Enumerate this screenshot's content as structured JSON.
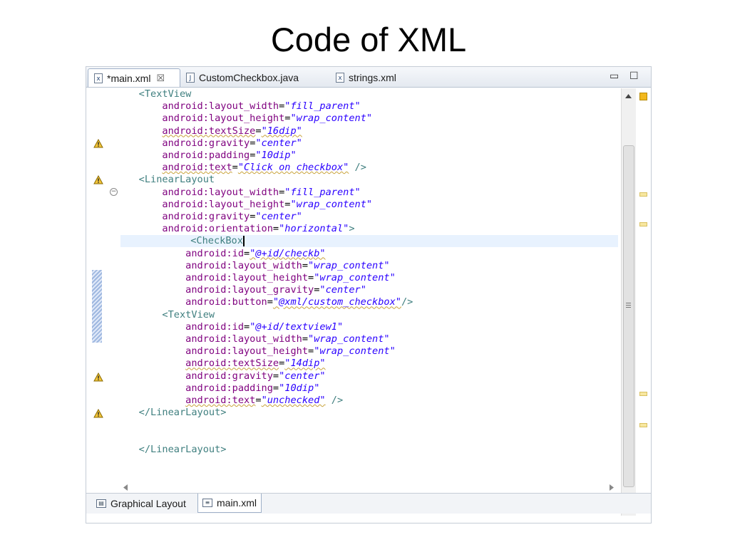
{
  "slide": {
    "title": "Code of XML"
  },
  "editor": {
    "tabs": [
      {
        "label": "*main.xml",
        "icon": "xml-file-icon",
        "close": "☒"
      },
      {
        "label": "CustomCheckbox.java",
        "icon": "java-file-icon"
      },
      {
        "label": "strings.xml",
        "icon": "xml-file-icon"
      }
    ],
    "window_buttons": {
      "minimize": "▭",
      "maximize": "☐"
    },
    "bottom_tabs": [
      {
        "label": "Graphical Layout",
        "icon": "layout-icon"
      },
      {
        "label": "main.xml",
        "icon": "source-icon"
      }
    ],
    "lines": [
      "<TextView",
      "    android:layout_width=\"fill_parent\"",
      "    android:layout_height=\"wrap_content\"",
      "    android:textSize=\"16dip\"",
      "    android:gravity=\"center\"",
      "    android:padding=\"10dip\"",
      "    android:text=\"Click on checkbox\" />",
      "<LinearLayout",
      "    android:layout_width=\"fill_parent\"",
      "    android:layout_height=\"wrap_content\"",
      "    android:gravity=\"center\"",
      "    android:orientation=\"horizontal\">",
      "    <CheckBox",
      "        android:id=\"@+id/checkb\"",
      "        android:layout_width=\"wrap_content\"",
      "        android:layout_height=\"wrap_content\"",
      "        android:layout_gravity=\"center\"",
      "        android:button=\"@xml/custom_checkbox\"/>",
      "    <TextView",
      "        android:id=\"@+id/textview1\"",
      "        android:layout_width=\"wrap_content\"",
      "        android:layout_height=\"wrap_content\"",
      "        android:textSize=\"14dip\"",
      "        android:gravity=\"center\"",
      "        android:padding=\"10dip\"",
      "        android:text=\"unchecked\" />",
      "</LinearLayout>",
      "",
      "",
      "</LinearLayout>"
    ],
    "colors": {
      "tag": "#3f7f7f",
      "attribute": "#7f007f",
      "string": "#2a00ff",
      "current_line": "#e8f2fe"
    }
  }
}
